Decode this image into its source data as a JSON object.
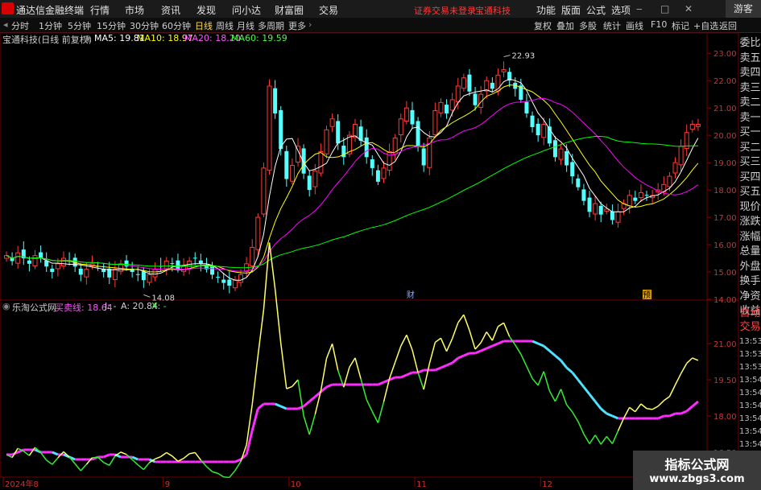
{
  "app": {
    "title": "通达信金融终端"
  },
  "menu": [
    "行情",
    "市场",
    "资讯",
    "发现",
    "问小达",
    "财富圈",
    "交易"
  ],
  "status": {
    "login": "证券交易未登录",
    "stock": "宝通科技"
  },
  "topright": [
    "功能",
    "版面",
    "公式",
    "选项"
  ],
  "guest": "游客",
  "periods": [
    "分时",
    "1分钟",
    "5分钟",
    "15分钟",
    "30分钟",
    "60分钟",
    "日线",
    "周线",
    "月线",
    "多周期",
    "更多"
  ],
  "active_period": "日线",
  "toolbar_buttons": [
    "复权",
    "叠加",
    "多股",
    "统计",
    "画线",
    "F10",
    "标记",
    "+自选",
    "返回"
  ],
  "main_legend": {
    "title": "宝通科技(日线 前复权)",
    "ma5": "MA5: 19.81",
    "ma10": "MA10: 18.97",
    "ma20": "MA20: 18.20",
    "ma60": "MA60: 19.59"
  },
  "sub_legend": {
    "title": "乐淘公式网",
    "name": "买卖线: 18.64",
    "j": "J: -",
    "a": "A: 20.84",
    "x": "X: -"
  },
  "markers": {
    "cai": "财",
    "yu": "预"
  },
  "side": {
    "buttons": [
      "委比",
      "卖五",
      "卖四",
      "卖三",
      "卖二",
      "卖一",
      "买一",
      "买二",
      "买三",
      "买四",
      "买五",
      "现价",
      "涨跌",
      "涨幅",
      "总量",
      "外盘",
      "换手",
      "净资",
      "收益",
      "自动",
      "交易"
    ],
    "times": [
      "13:53",
      "13:53",
      "13:53",
      "13:54",
      "13:54",
      "13:54",
      "13:54",
      "13:54",
      "13:54",
      "13:54",
      "13:54"
    ]
  },
  "watermark": {
    "line1": "指标公式网",
    "line2": "www.zbgs3.com"
  },
  "colors": {
    "up": "#ff3a3a",
    "down": "#54ffff",
    "ma5": "#ffffff",
    "ma10": "#ffff00",
    "ma20": "#ff00ff",
    "ma60": "#00ff00"
  },
  "chart_data": [
    {
      "type": "candlestick",
      "title": "宝通科技(日线 前复权)",
      "ylim": [
        14.0,
        23.3
      ],
      "yticks": [
        14.0,
        15.0,
        16.0,
        17.0,
        18.0,
        19.0,
        20.0,
        21.0,
        22.0,
        23.0
      ],
      "x_labels": [
        "2024年8",
        "9",
        "10",
        "11",
        "12",
        "1"
      ],
      "annotations": {
        "high": "22.93",
        "low": "14.08"
      },
      "closes": [
        15.6,
        15.4,
        15.7,
        15.5,
        15.3,
        15.6,
        15.5,
        15.2,
        15.0,
        15.3,
        15.5,
        15.4,
        15.2,
        14.9,
        15.1,
        15.3,
        15.2,
        15.0,
        14.8,
        15.1,
        15.3,
        15.2,
        15.0,
        14.9,
        14.7,
        14.9,
        15.1,
        15.2,
        15.4,
        15.3,
        15.1,
        15.2,
        15.4,
        15.5,
        15.3,
        15.1,
        14.9,
        14.8,
        14.6,
        14.5,
        14.7,
        14.9,
        15.3,
        15.9,
        17.0,
        18.8,
        21.8,
        20.8,
        19.5,
        18.4,
        18.9,
        19.6,
        18.6,
        18.0,
        18.7,
        19.4,
        20.2,
        20.6,
        19.7,
        19.2,
        20.0,
        20.4,
        19.8,
        19.2,
        18.8,
        18.3,
        18.8,
        19.4,
        19.9,
        20.6,
        21.0,
        20.4,
        19.6,
        18.9,
        19.9,
        20.9,
        21.2,
        20.8,
        21.3,
        21.8,
        22.1,
        21.6,
        21.1,
        21.5,
        22.0,
        21.7,
        22.2,
        22.4,
        22.0,
        21.7,
        21.3,
        20.8,
        20.3,
        20.0,
        20.4,
        19.7,
        19.2,
        19.5,
        18.9,
        18.5,
        18.1,
        17.6,
        17.2,
        17.5,
        17.1,
        17.3,
        16.9,
        17.2,
        17.5,
        17.8,
        17.6,
        17.9,
        17.8,
        17.8,
        18.0,
        18.2,
        18.5,
        19.0,
        19.6,
        20.1,
        20.4,
        20.4
      ]
    },
    {
      "type": "line",
      "title": "乐淘公式网",
      "ylim": [
        15.5,
        22.3
      ],
      "yticks": [
        16.5,
        18.0,
        19.5,
        21.0
      ],
      "series": [
        {
          "name": "买卖线",
          "values": [
            16.4,
            16.4,
            16.5,
            16.6,
            16.6,
            16.6,
            16.5,
            16.5,
            16.5,
            16.4,
            16.4,
            16.3,
            16.2,
            16.2,
            16.2,
            16.2,
            16.3,
            16.3,
            16.4,
            16.4,
            16.3,
            16.3,
            16.3,
            16.2,
            16.2,
            16.2,
            16.1,
            16.1,
            16.1,
            16.1,
            16.1,
            16.1,
            16.1,
            16.1,
            16.1,
            16.1,
            16.1,
            16.1,
            16.1,
            16.1,
            16.1,
            16.2,
            16.4,
            17.4,
            18.3,
            18.5,
            18.5,
            18.5,
            18.4,
            18.3,
            18.3,
            18.3,
            18.4,
            18.6,
            18.8,
            19.0,
            19.2,
            19.3,
            19.3,
            19.3,
            19.3,
            19.3,
            19.3,
            19.3,
            19.3,
            19.3,
            19.4,
            19.5,
            19.6,
            19.6,
            19.7,
            19.8,
            19.8,
            19.9,
            19.9,
            19.9,
            20.0,
            20.1,
            20.2,
            20.4,
            20.5,
            20.6,
            20.6,
            20.7,
            20.8,
            20.9,
            21.0,
            21.1,
            21.1,
            21.1,
            21.1,
            21.1,
            21.1,
            21.0,
            20.9,
            20.7,
            20.5,
            20.3,
            20.0,
            19.8,
            19.5,
            19.2,
            18.9,
            18.6,
            18.3,
            18.1,
            18.0,
            17.9,
            17.9,
            17.9,
            17.9,
            17.9,
            17.9,
            17.9,
            17.9,
            18.0,
            18.0,
            18.1,
            18.1,
            18.2,
            18.4,
            18.6
          ]
        }
      ]
    }
  ]
}
